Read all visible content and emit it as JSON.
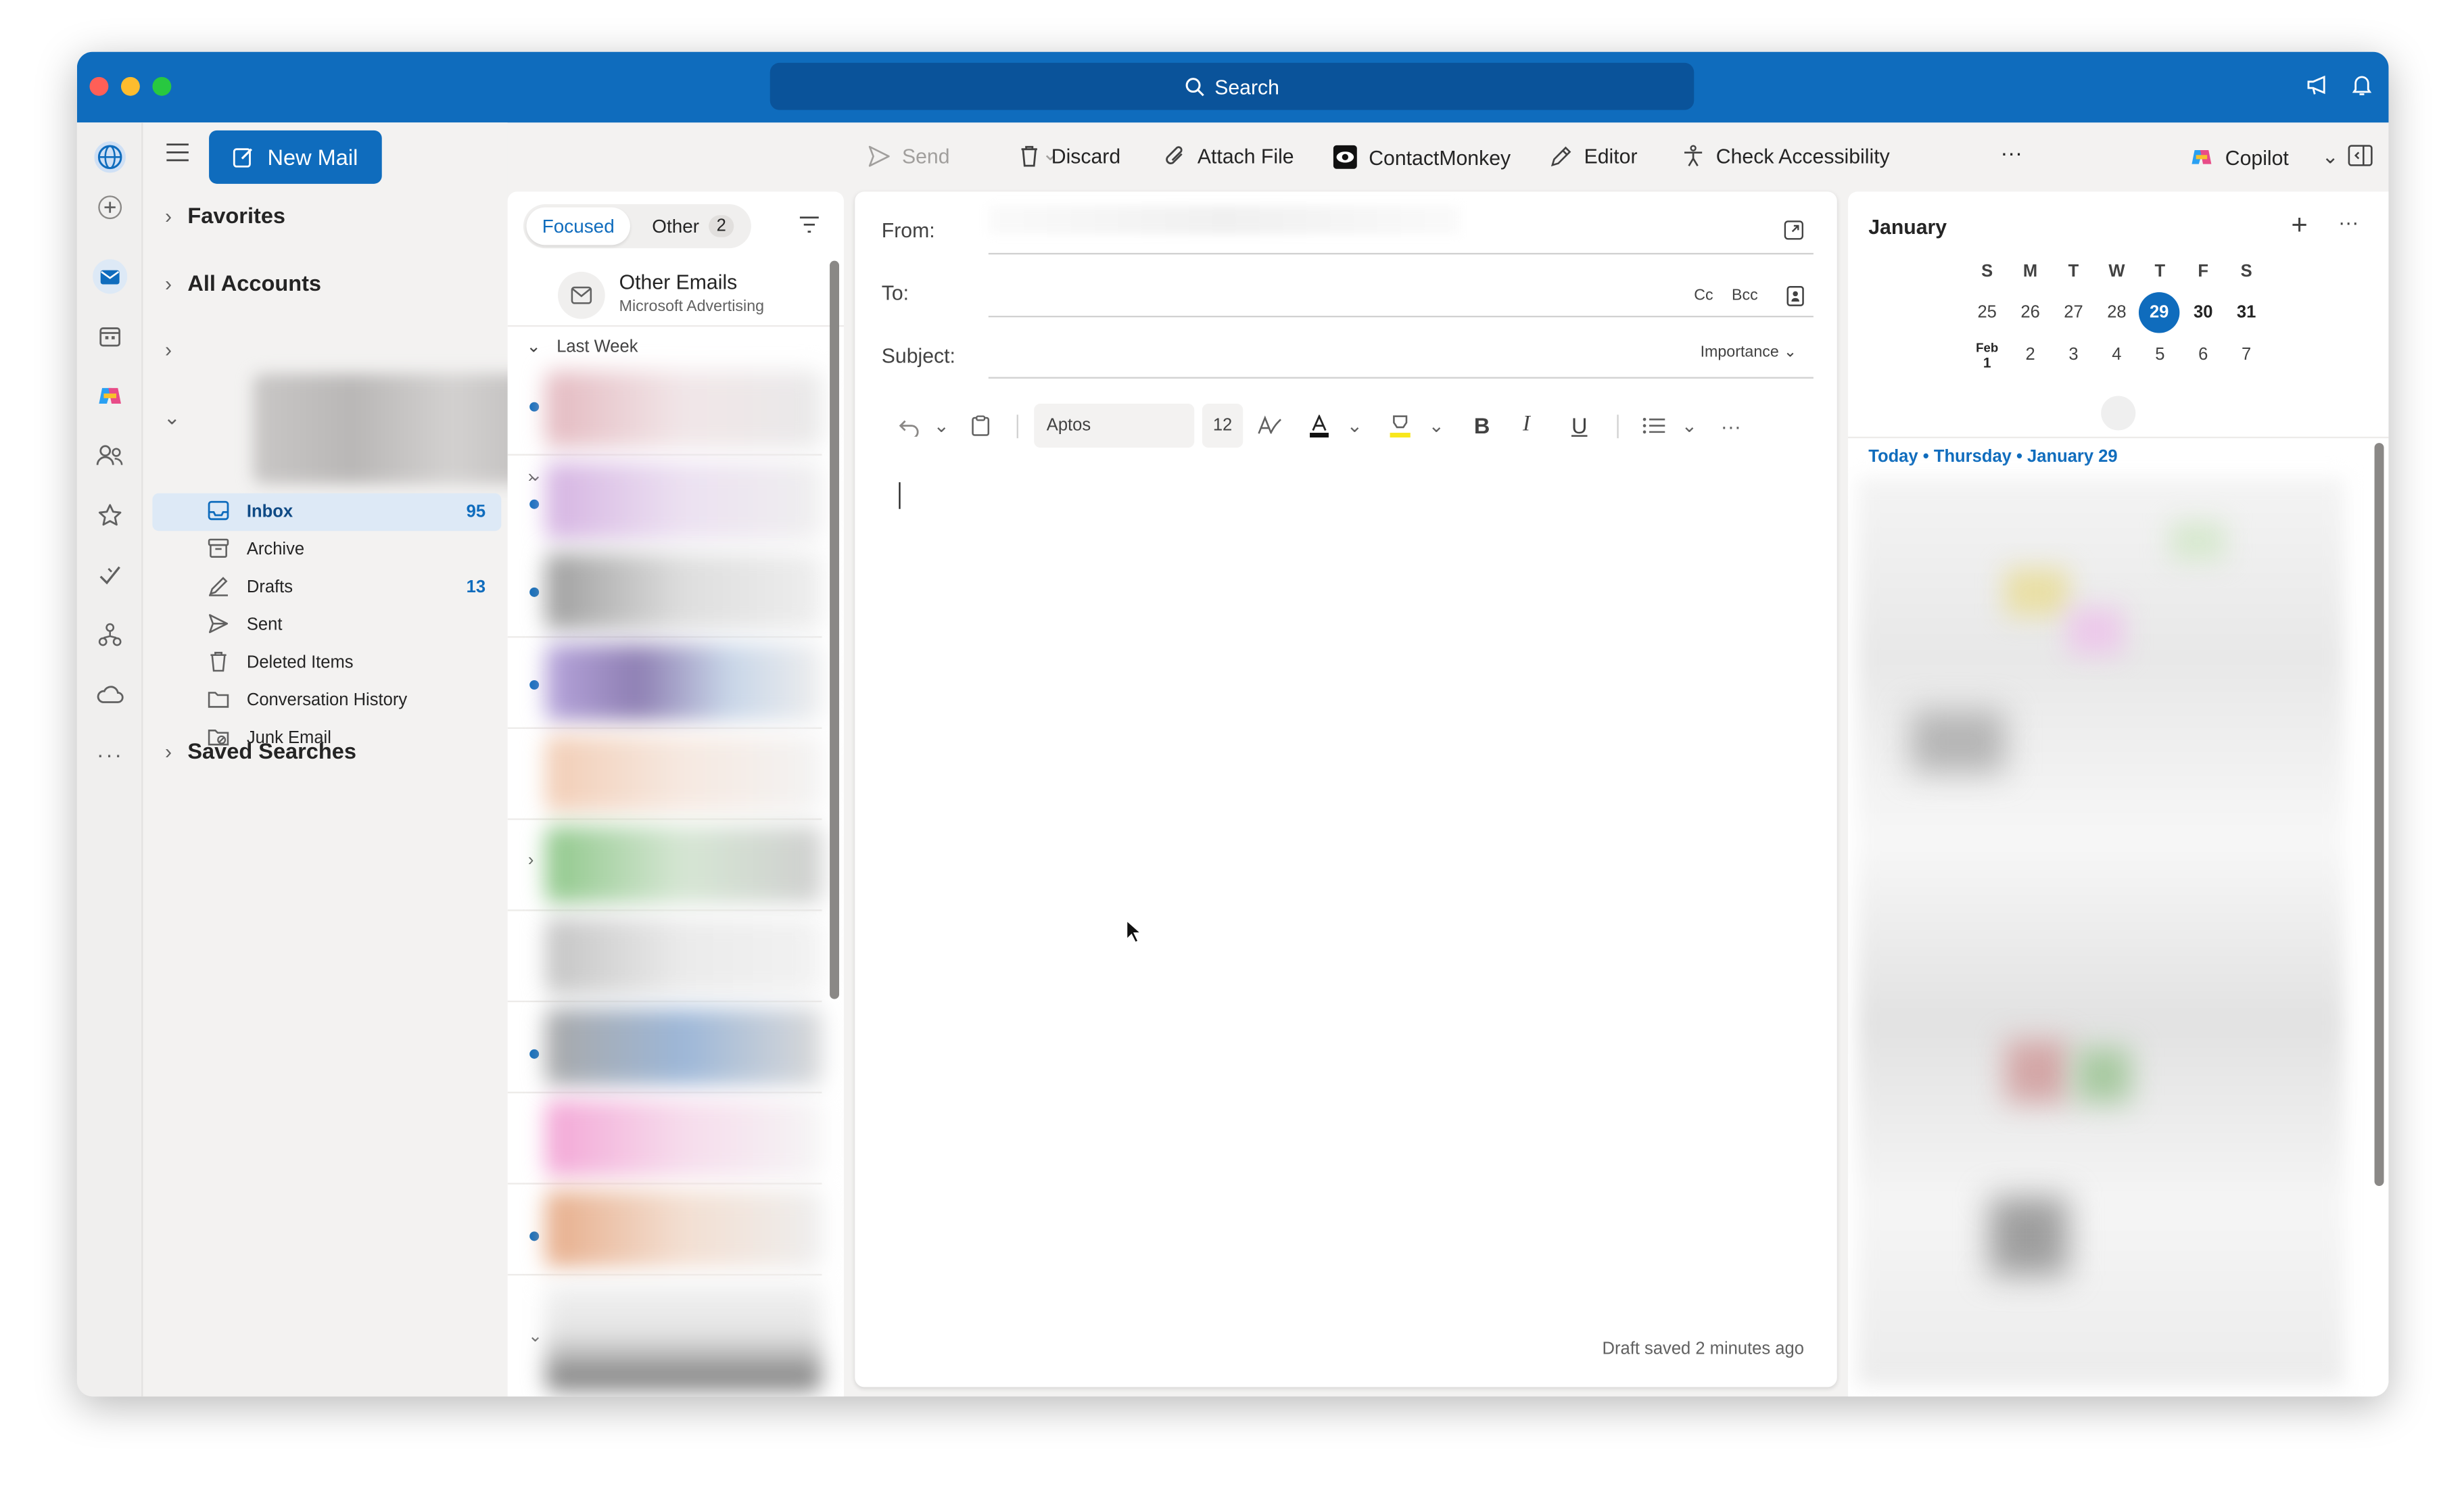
{
  "titlebar": {
    "search_label": "Search"
  },
  "nav": {
    "new_mail_label": "New Mail",
    "favorites_label": "Favorites",
    "all_accounts_label": "All Accounts",
    "saved_searches_label": "Saved Searches",
    "folders": [
      {
        "label": "Inbox",
        "count": "95",
        "icon": "inbox-icon"
      },
      {
        "label": "Archive",
        "count": "",
        "icon": "archive-icon"
      },
      {
        "label": "Drafts",
        "count": "13",
        "icon": "drafts-icon"
      },
      {
        "label": "Sent",
        "count": "",
        "icon": "sent-icon"
      },
      {
        "label": "Deleted Items",
        "count": "",
        "icon": "trash-icon"
      },
      {
        "label": "Conversation History",
        "count": "",
        "icon": "folder-icon"
      },
      {
        "label": "Junk Email",
        "count": "",
        "icon": "junk-icon"
      }
    ]
  },
  "toolbar": {
    "send_label": "Send",
    "discard_label": "Discard",
    "attach_label": "Attach File",
    "contactmonkey_label": "ContactMonkey",
    "editor_label": "Editor",
    "accessibility_label": "Check Accessibility",
    "more_label": "···",
    "copilot_label": "Copilot"
  },
  "message_list": {
    "tab_focused": "Focused",
    "tab_other": "Other",
    "tab_other_count": "2",
    "other_emails_title": "Other Emails",
    "other_emails_sub": "Microsoft Advertising",
    "group_label": "Last Week"
  },
  "compose": {
    "from_label": "From:",
    "to_label": "To:",
    "cc_label": "Cc",
    "bcc_label": "Bcc",
    "subject_label": "Subject:",
    "importance_label": "Importance",
    "font_name": "Aptos",
    "font_size": "12",
    "draft_status": "Draft saved 2 minutes ago"
  },
  "calendar": {
    "month_label": "January",
    "weekdays": [
      "S",
      "M",
      "T",
      "W",
      "T",
      "F",
      "S"
    ],
    "week1": [
      "25",
      "26",
      "27",
      "28",
      "29",
      "30",
      "31"
    ],
    "week2_first_month": "Feb",
    "week2": [
      "1",
      "2",
      "3",
      "4",
      "5",
      "6",
      "7"
    ],
    "today_label": "Today",
    "today_date": "Thursday • January 29",
    "selected_day": "29"
  },
  "colors": {
    "accent": "#0f6cbd",
    "titlebar": "#0f6cbd"
  }
}
